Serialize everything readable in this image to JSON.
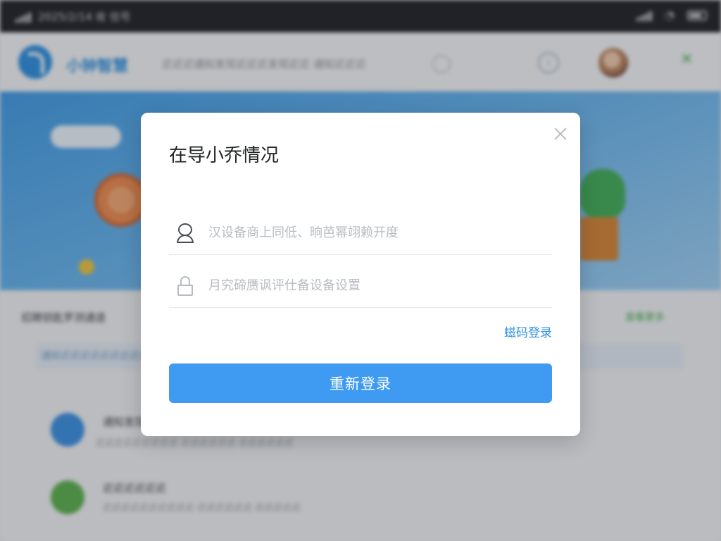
{
  "statusbar": {
    "time": "2025/2/14 收 信号"
  },
  "app": {
    "title": "小钟智慧",
    "subtitle": "近近近通知发现近近近发现近近 通知近近近"
  },
  "section": {
    "title": "招聘钥匙罗测通道",
    "link": "查看更多",
    "notice": "通知近近近近近近近近近近近近近近近近近近近",
    "rows": [
      {
        "title": "通知发现",
        "desc": "近近近近近近近近近 近近近近近近 近近近近近近"
      },
      {
        "title": "近近近近近近",
        "desc": "近近近近近近近近近近 近近近近近近 近近近近近"
      }
    ]
  },
  "modal": {
    "title": "在导小乔情况",
    "account_placeholder": "汉设备商上同低、晌芭幂翊赖开度",
    "password_placeholder": "月究碲赝讽评仕备设备设置",
    "alt_login_label": "螆码登录",
    "submit_label": "重新登录"
  },
  "colors": {
    "primary": "#3f9bf2",
    "link": "#2f8fe0",
    "banner": "#3f9be5"
  },
  "icons": [
    "signal-icon",
    "wifi-icon",
    "battery-icon",
    "info-icon",
    "close-icon",
    "user-icon",
    "lock-icon"
  ]
}
